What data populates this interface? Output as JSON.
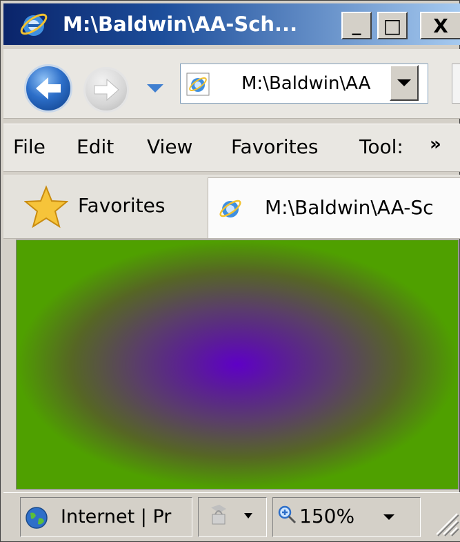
{
  "window": {
    "title": "M:\\Baldwin\\AA-Sch...",
    "minimize_label": "_",
    "maximize_label": "□",
    "close_label": "X"
  },
  "nav": {
    "address": "M:\\Baldwin\\AA"
  },
  "menu": {
    "items": [
      "File",
      "Edit",
      "View",
      "Favorites",
      "Tool:"
    ],
    "more": "»"
  },
  "favorites": {
    "label": "Favorites"
  },
  "tab": {
    "label": "M:\\Baldwin\\AA-Sc"
  },
  "content": {
    "center_color": "#5e00c6",
    "edge_color": "#4fa000"
  },
  "status": {
    "zone": "Internet | Pr",
    "zoom": "150%"
  }
}
